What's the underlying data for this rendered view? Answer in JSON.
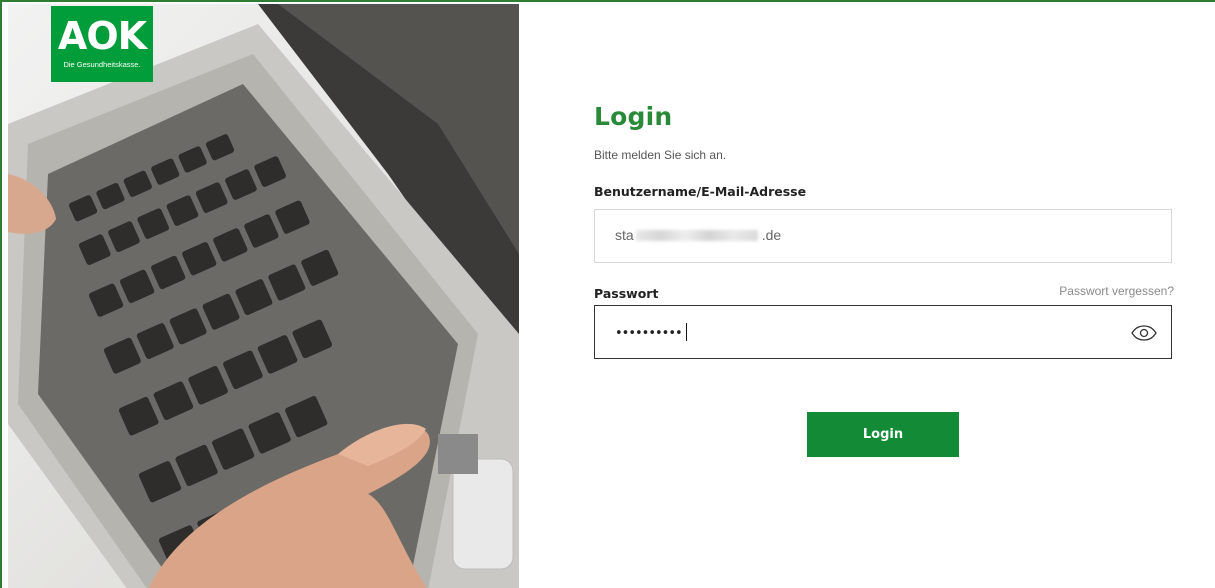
{
  "brand": {
    "logo_text": "AOK",
    "tagline": "Die Gesundheitskasse.",
    "color": "#009d3a"
  },
  "login": {
    "title": "Login",
    "subtitle": "Bitte melden Sie sich an.",
    "username_label": "Benutzername/E-Mail-Adresse",
    "username_prefix": "sta",
    "username_suffix": ".de",
    "password_label": "Passwort",
    "forgot_link": "Passwort vergessen?",
    "password_masked": "••••••••••",
    "show_password_icon": "eye-icon",
    "submit_label": "Login",
    "accent_color": "#2a8a3a",
    "button_color": "#138a35"
  }
}
